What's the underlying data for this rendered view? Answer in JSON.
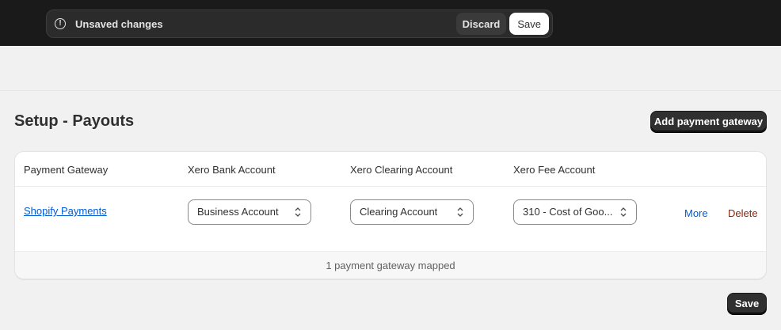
{
  "save_bar": {
    "message": "Unsaved changes",
    "discard_label": "Discard",
    "save_label": "Save"
  },
  "page": {
    "title": "Setup - Payouts",
    "add_button_label": "Add payment gateway",
    "save_button_label": "Save"
  },
  "table": {
    "columns": [
      "Payment Gateway",
      "Xero Bank Account",
      "Xero Clearing Account",
      "Xero Fee Account"
    ],
    "rows": [
      {
        "gateway": "Shopify Payments",
        "bank_account": "Business Account",
        "clearing_account": "Clearing Account",
        "fee_account": "310 - Cost of Goo...",
        "more_label": "More",
        "delete_label": "Delete"
      }
    ],
    "footer_text": "1 payment gateway mapped"
  },
  "icons": {
    "warning": "alert-circle-icon",
    "select": "chevron-up-down-icon"
  },
  "colors": {
    "topbar": "#1a1a1a",
    "link": "#005bd3",
    "delete": "#8e1f0b",
    "primary_button": "#303030"
  }
}
